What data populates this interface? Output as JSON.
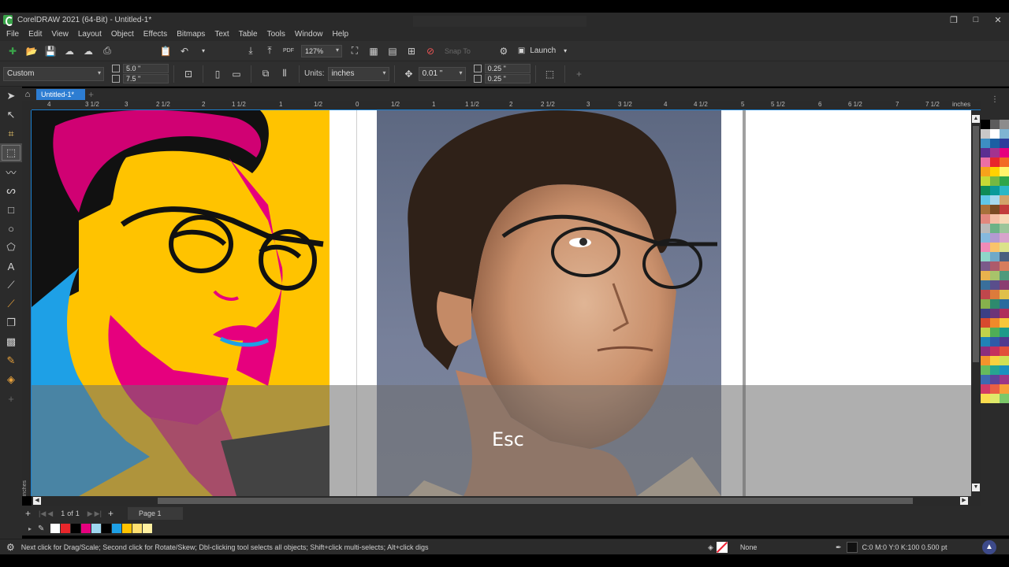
{
  "window": {
    "title": "CorelDRAW 2021 (64-Bit) - Untitled-1*",
    "controls": [
      "restore-icon",
      "maximize-icon",
      "close-icon"
    ]
  },
  "menu": [
    "File",
    "Edit",
    "View",
    "Layout",
    "Object",
    "Effects",
    "Bitmaps",
    "Text",
    "Table",
    "Tools",
    "Window",
    "Help"
  ],
  "toolbar": {
    "zoom": "127%",
    "snap_to": "Snap To",
    "launch": "Launch"
  },
  "property_bar": {
    "page_size": "Custom",
    "width": "5.0 \"",
    "height": "7.5 \"",
    "units_label": "Units:",
    "units_value": "inches",
    "nudge": "0.01 \"",
    "dup_x": "0.25 \"",
    "dup_y": "0.25 \""
  },
  "document": {
    "tab": "Untitled-1*",
    "ruler_unit": "inches",
    "ruler_ticks": [
      "4",
      "3 1/2",
      "3",
      "2 1/2",
      "2",
      "1 1/2",
      "1",
      "1/2",
      "0",
      "1/2",
      "1",
      "1 1/2",
      "2",
      "2 1/2",
      "3",
      "3 1/2",
      "4",
      "4 1/2",
      "5",
      "5 1/2",
      "6",
      "6 1/2",
      "7",
      "7 1/2"
    ],
    "vertical_ruler_label": "inches"
  },
  "overlay": {
    "key_hint": "Esc"
  },
  "pagebar": {
    "page_index": "1",
    "page_of": "of",
    "page_total": "1",
    "page_tab": "Page 1"
  },
  "status": {
    "hint": "Next click for Drag/Scale; Second click for Rotate/Skew; Dbl-clicking tool selects all objects; Shift+click multi-selects; Alt+click digs",
    "fill": "None",
    "outline": "C:0 M:0 Y:0 K:100  0.500 pt"
  },
  "colors": {
    "accent": "#2d7dd2",
    "pop_yellow": "#ffc300",
    "pop_pink": "#f0288c",
    "pop_blue": "#1ea0e6"
  },
  "doc_palette": [
    "#ffffff",
    "#e8262b",
    "#000000",
    "#e6007e",
    "#9fd7f0",
    "#000000",
    "#1ea0e6",
    "#ffc300",
    "#ffe070",
    "#fff0a0"
  ],
  "color_palette": [
    "#000000",
    "#5c5c5c",
    "#8c8c8c",
    "#c8c8c8",
    "#ffffff",
    "#7fb4d2",
    "#3d8ec3",
    "#1b5fa3",
    "#2e3c9c",
    "#5c2e91",
    "#a3338e",
    "#e6007e",
    "#ec6fa3",
    "#e8262b",
    "#f26a24",
    "#f7a21b",
    "#ffd200",
    "#fff46b",
    "#c6d935",
    "#74b843",
    "#2ea54a",
    "#0f8b57",
    "#0a9a9a",
    "#2bb7c6",
    "#5fc7e8",
    "#a7d8ef",
    "#d2a26a",
    "#a7713a",
    "#7a4b24",
    "#c23b3b",
    "#e2877d",
    "#f4bfa7",
    "#f7d7b5",
    "#b9b9b9",
    "#6bb287",
    "#9cc59a",
    "#85b9de",
    "#b39ad1",
    "#d8a3cc",
    "#f08bb7",
    "#f9c36b",
    "#dbe28a",
    "#8ed6c9",
    "#6fa9c8",
    "#49607f",
    "#7b5a8a",
    "#ad5b6b",
    "#d67d5c",
    "#e9b24d",
    "#a8c36a",
    "#4e9a7c",
    "#3a6f9b",
    "#5a4e8c",
    "#8a3d70",
    "#c0474c",
    "#dd7b3b",
    "#e0c04a",
    "#86b04c",
    "#2e8a6e",
    "#2b6b9e",
    "#3b3f85",
    "#6d3478",
    "#b02e5a",
    "#d8492e",
    "#f08a2a",
    "#f7c73a",
    "#c1d24a",
    "#4fae56",
    "#1e9a8a",
    "#1f83b6",
    "#2f5aa8",
    "#52398e",
    "#8c2e7d",
    "#c52f5d",
    "#e2503a",
    "#f4932c",
    "#f9d13f",
    "#d0e055",
    "#66bb5d",
    "#26a591",
    "#1b90c0",
    "#3d6ab0",
    "#5e449a",
    "#9b3787",
    "#d23a66",
    "#eb5f44",
    "#f7a038",
    "#fbdc4e",
    "#dfe96a",
    "#7cc86a"
  ]
}
